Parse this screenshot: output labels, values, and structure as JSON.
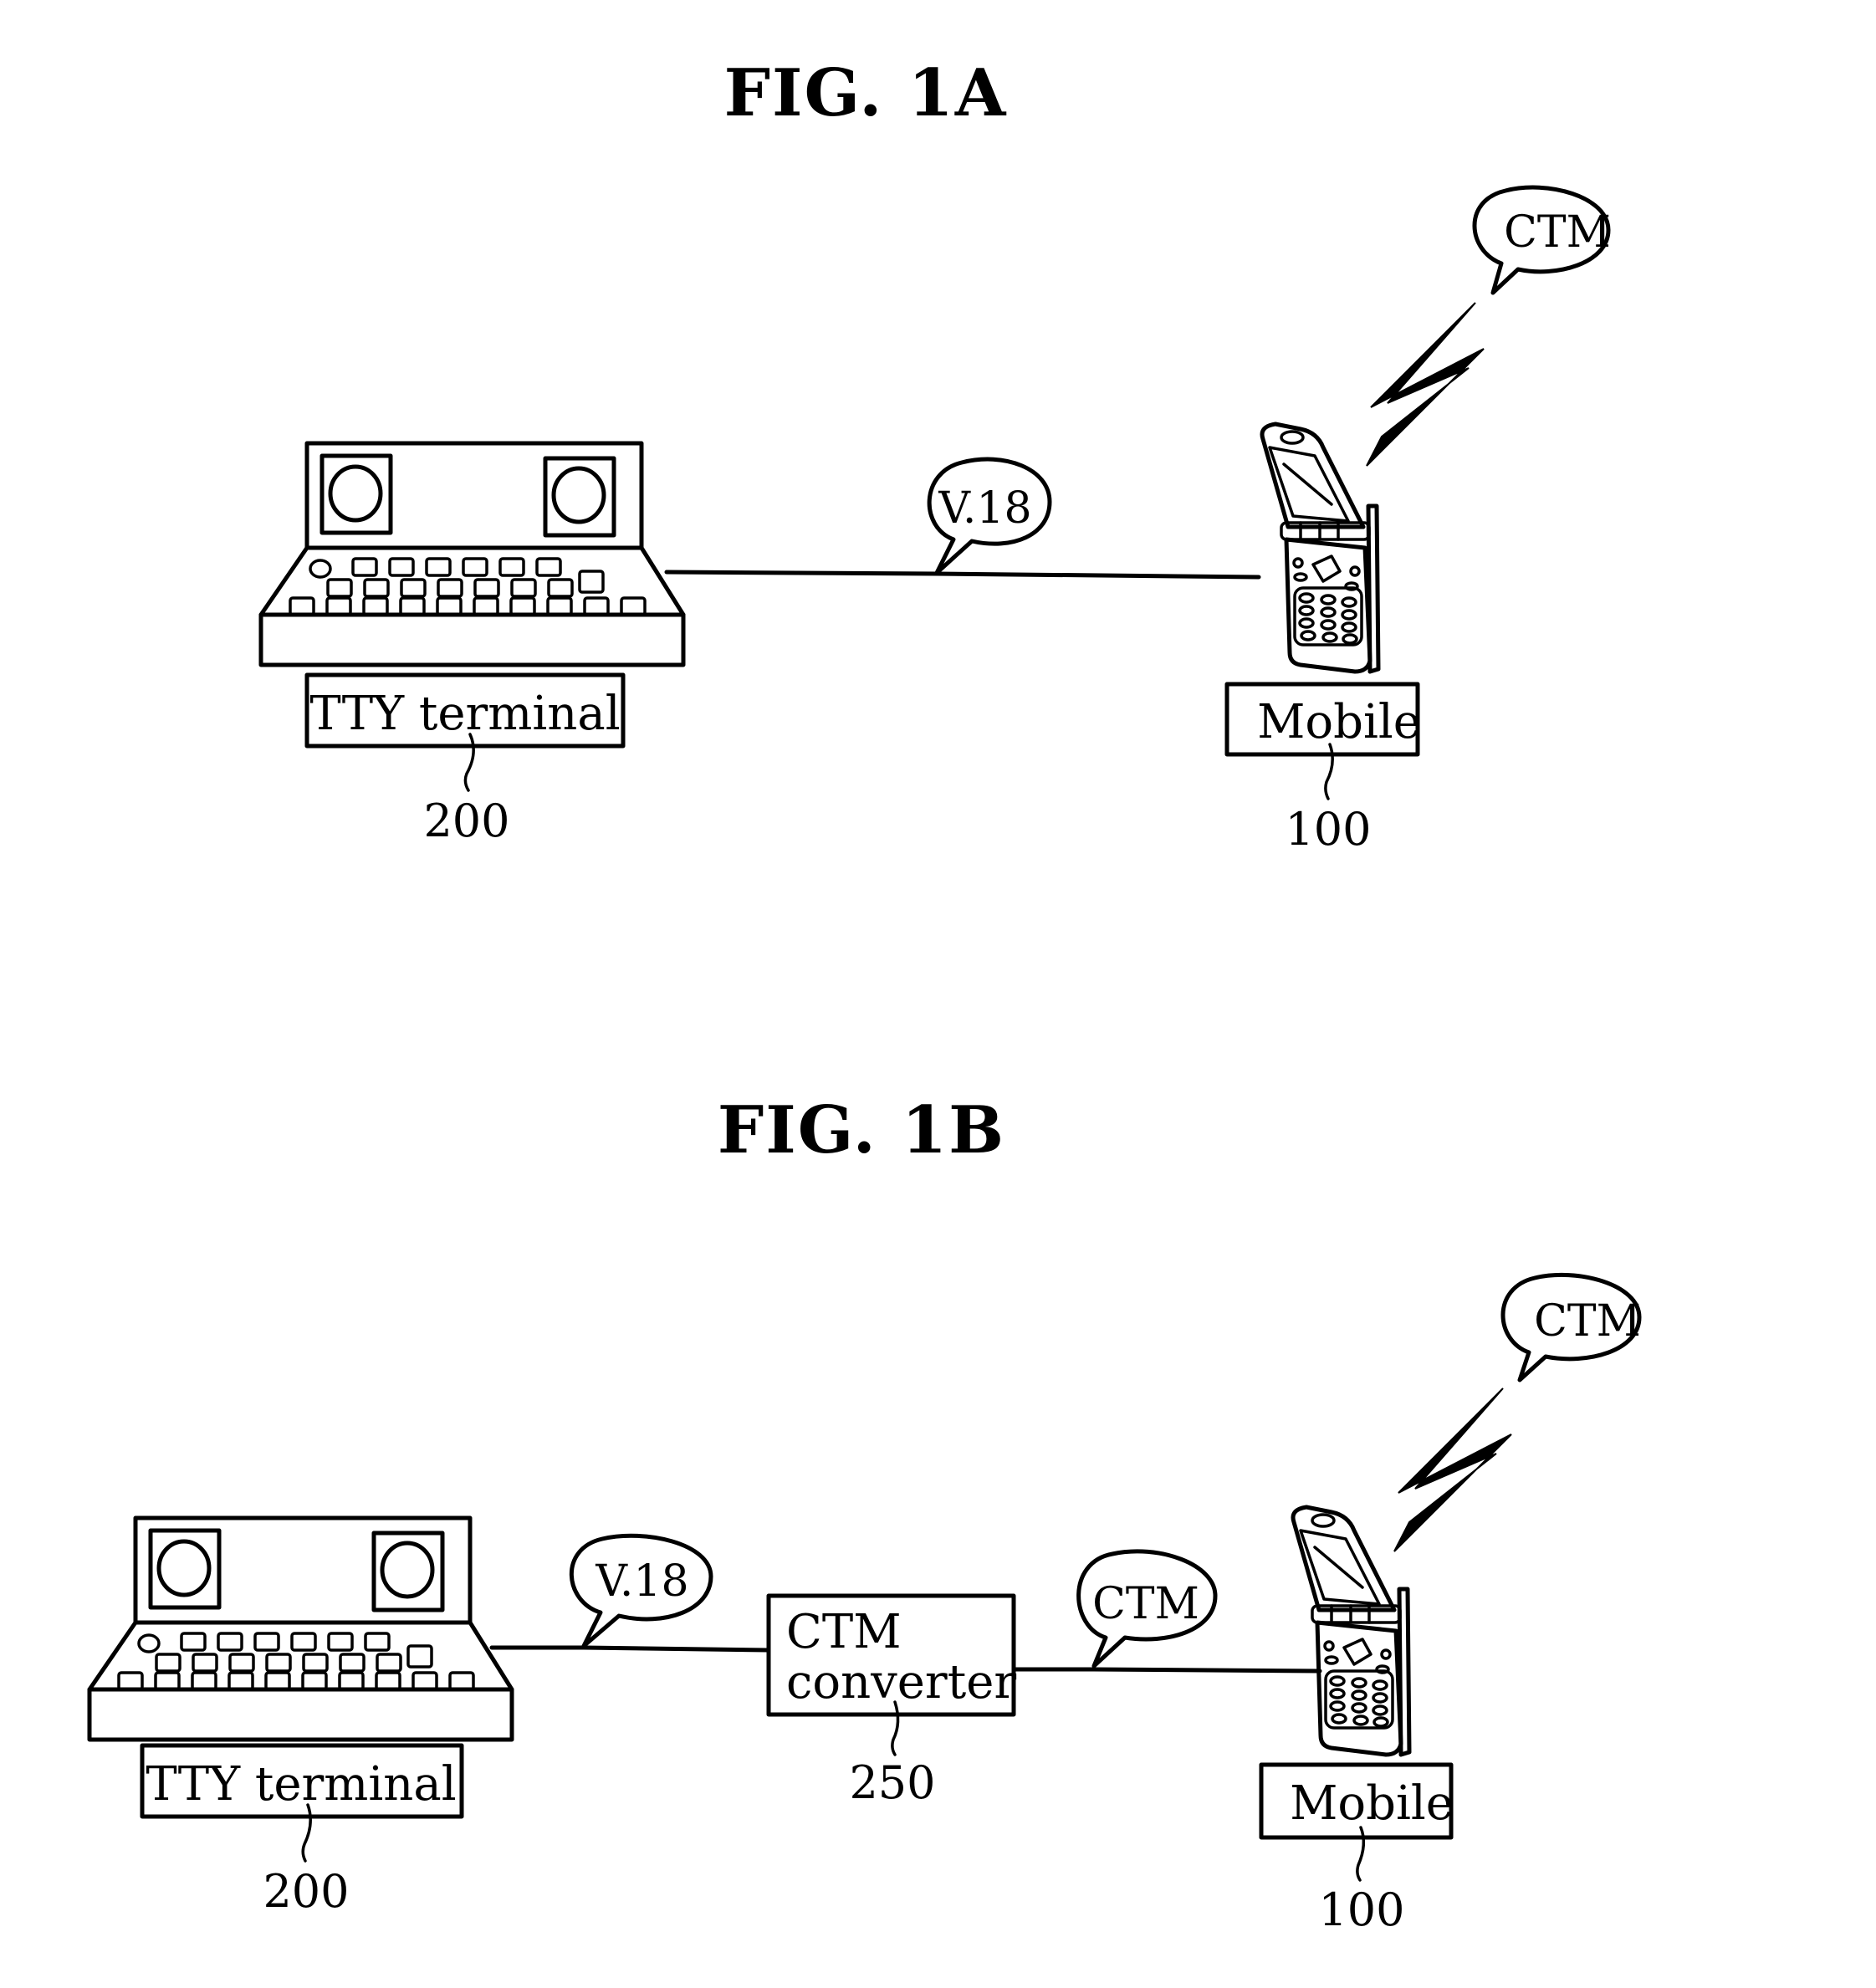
{
  "figures": [
    {
      "id": "1A",
      "title": "FIG. 1A",
      "tty": {
        "label": "TTY terminal",
        "ref": "200"
      },
      "link_tty_mobile": {
        "protocol": "V.18"
      },
      "mobile": {
        "label": "Mobile",
        "ref": "100",
        "air_protocol": "CTM"
      }
    },
    {
      "id": "1B",
      "title": "FIG. 1B",
      "tty": {
        "label": "TTY terminal",
        "ref": "200"
      },
      "link_tty_converter": {
        "protocol": "V.18"
      },
      "converter": {
        "label_line1": "CTM",
        "label_line2": "converter",
        "ref": "250"
      },
      "link_converter_mobile": {
        "protocol": "CTM"
      },
      "mobile": {
        "label": "Mobile",
        "ref": "100",
        "air_protocol": "CTM"
      }
    }
  ],
  "colors": {
    "ink": "#000000",
    "paper": "#ffffff"
  }
}
